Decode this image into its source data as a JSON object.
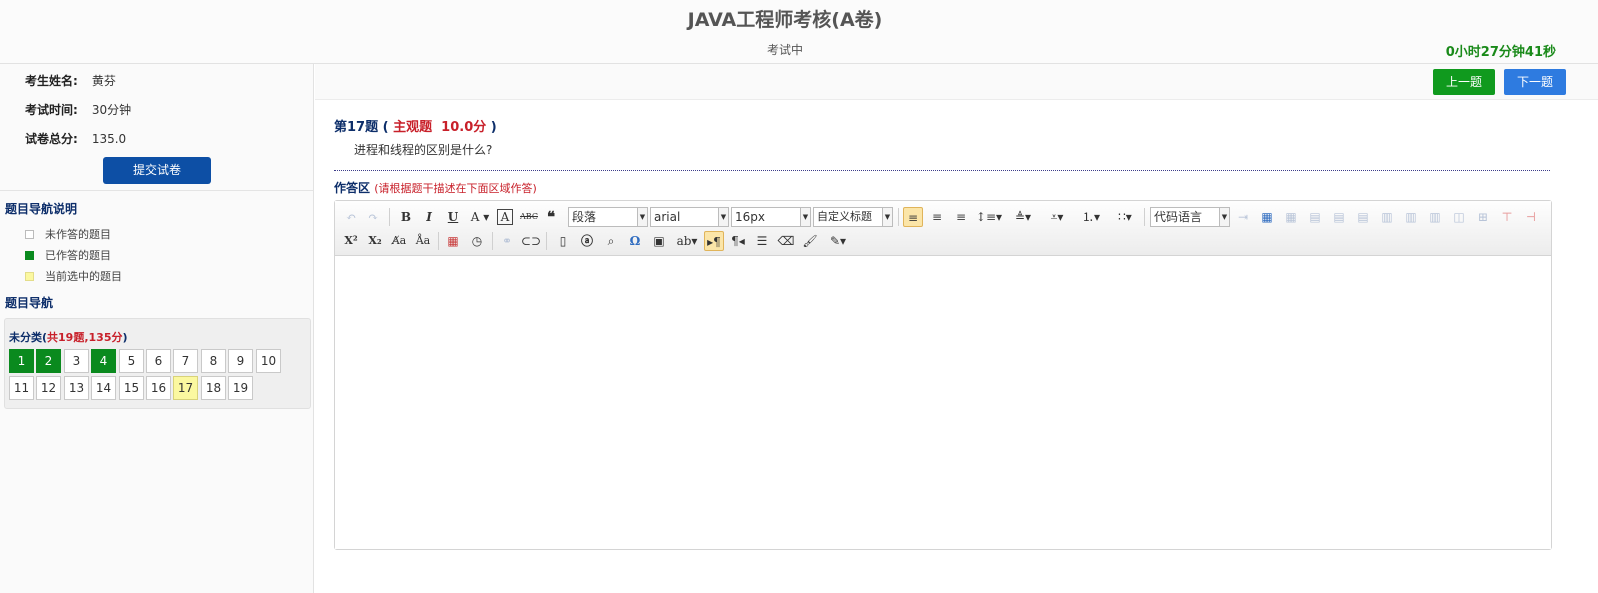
{
  "header": {
    "title": "JAVA工程师考核(A卷)",
    "status": "考试中",
    "timer": "0小时27分钟41秒"
  },
  "sidebar": {
    "info": [
      {
        "key": "考生姓名:",
        "value": "黄芬"
      },
      {
        "key": "考试时间:",
        "value": "30分钟"
      },
      {
        "key": "试卷总分:",
        "value": "135.0"
      }
    ],
    "submit_label": "提交试卷",
    "legend_title": "题目导航说明",
    "legend": [
      {
        "label": "未作答的题目",
        "color": "#ffffff"
      },
      {
        "label": "已作答的题目",
        "color": "#0a8a1e"
      },
      {
        "label": "当前选中的题目",
        "color": "#fbf8a0"
      }
    ],
    "nav_title": "题目导航",
    "category": {
      "name": "未分类(",
      "summary": "共19题,135分",
      "close": ")"
    },
    "questions": [
      {
        "n": "1",
        "state": "done"
      },
      {
        "n": "2",
        "state": "done"
      },
      {
        "n": "3",
        "state": "todo"
      },
      {
        "n": "4",
        "state": "done"
      },
      {
        "n": "5",
        "state": "todo"
      },
      {
        "n": "6",
        "state": "todo"
      },
      {
        "n": "7",
        "state": "todo"
      },
      {
        "n": "8",
        "state": "todo"
      },
      {
        "n": "9",
        "state": "todo"
      },
      {
        "n": "10",
        "state": "todo"
      },
      {
        "n": "11",
        "state": "todo"
      },
      {
        "n": "12",
        "state": "todo"
      },
      {
        "n": "13",
        "state": "todo"
      },
      {
        "n": "14",
        "state": "todo"
      },
      {
        "n": "15",
        "state": "todo"
      },
      {
        "n": "16",
        "state": "todo"
      },
      {
        "n": "17",
        "state": "current"
      },
      {
        "n": "18",
        "state": "todo"
      },
      {
        "n": "19",
        "state": "todo"
      }
    ]
  },
  "main": {
    "prev_label": "上一题",
    "next_label": "下一题",
    "question": {
      "number": "第17题 (",
      "type": "主观题",
      "score": "10.0分",
      "close": ")",
      "text": "进程和线程的区别是什么?"
    },
    "answer_title": "作答区",
    "answer_hint": "(请根据题干描述在下面区域作答)"
  },
  "editor": {
    "paragraph": "段落",
    "font": "arial",
    "size": "16px",
    "heading": "自定义标题",
    "code": "代码语言"
  },
  "colors": {
    "done": "#0a8a1e",
    "current": "#fbf8a0",
    "prev_btn": "#109a1e",
    "next_btn": "#2e7be0",
    "submit_btn": "#0d4fa5",
    "accent_red": "#c8202a"
  }
}
